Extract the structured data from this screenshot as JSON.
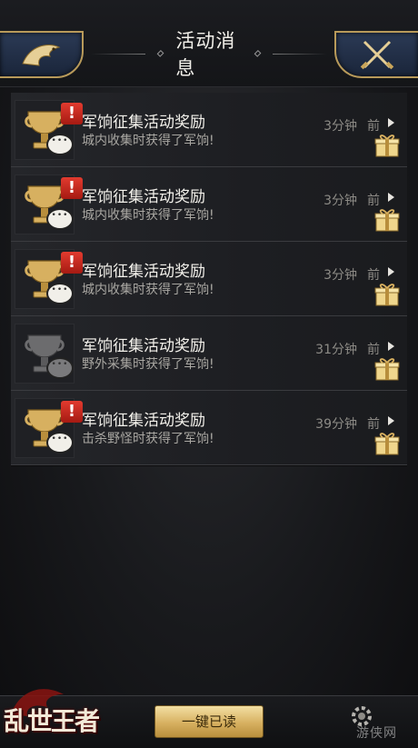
{
  "header": {
    "title": "活动消息",
    "back_icon": "dragon-back-icon",
    "close_icon": "crossed-swords-close-icon"
  },
  "messages": [
    {
      "title": "军饷征集活动奖励",
      "subtitle": "城内收集时获得了军饷!",
      "time": "3分钟",
      "suffix": "前",
      "unread": true,
      "icon": "gold-cup-icon"
    },
    {
      "title": "军饷征集活动奖励",
      "subtitle": "城内收集时获得了军饷!",
      "time": "3分钟",
      "suffix": "前",
      "unread": true,
      "icon": "gold-cup-icon"
    },
    {
      "title": "军饷征集活动奖励",
      "subtitle": "城内收集时获得了军饷!",
      "time": "3分钟",
      "suffix": "前",
      "unread": true,
      "icon": "gold-cup-icon"
    },
    {
      "title": "军饷征集活动奖励",
      "subtitle": "野外采集时获得了军饷!",
      "time": "31分钟",
      "suffix": "前",
      "unread": false,
      "icon": "grey-cup-icon"
    },
    {
      "title": "军饷征集活动奖励",
      "subtitle": "击杀野怪时获得了军饷!",
      "time": "39分钟",
      "suffix": "前",
      "unread": true,
      "icon": "gold-cup-icon"
    }
  ],
  "footer": {
    "mark_all_read_label": "一键已读",
    "logo_text": "乱世王者",
    "watermark": "游侠网"
  },
  "colors": {
    "gold": "#d7b060",
    "badge_red": "#d2301f",
    "frame_blue": "#2b3a55"
  }
}
